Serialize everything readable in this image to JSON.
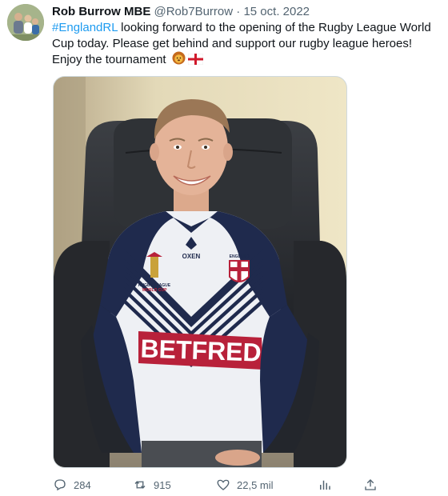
{
  "author": {
    "name": "Rob Burrow MBE",
    "handle": "@Rob7Burrow",
    "separator": "·",
    "date": "15 oct. 2022"
  },
  "tweet": {
    "hashtag": "#EnglandRL",
    "text": " looking forward to the opening of the Rugby League World Cup today. Please get behind and support our rugby league heroes! Enjoy the tournament",
    "emojis": [
      "lion-face-emoji",
      "england-flag-emoji"
    ]
  },
  "media": {
    "description_icon": "photo",
    "shirt_text": {
      "sponsor": "BETFRED",
      "brand": "OXEN",
      "crest_top": "ENGLAND",
      "badge_line1": "RUGBY LEAGUE",
      "badge_line2": "WORLD CUP"
    }
  },
  "actions": {
    "replies": "284",
    "retweets": "915",
    "likes": "22,5 mil",
    "views_icon": "analytics-icon",
    "share_icon": "share-icon"
  },
  "colors": {
    "link": "#1d9bf0",
    "secondary": "#536471",
    "primary": "#0f1419",
    "shirt_navy": "#1f2a4d",
    "sponsor_red": "#b8213a"
  }
}
